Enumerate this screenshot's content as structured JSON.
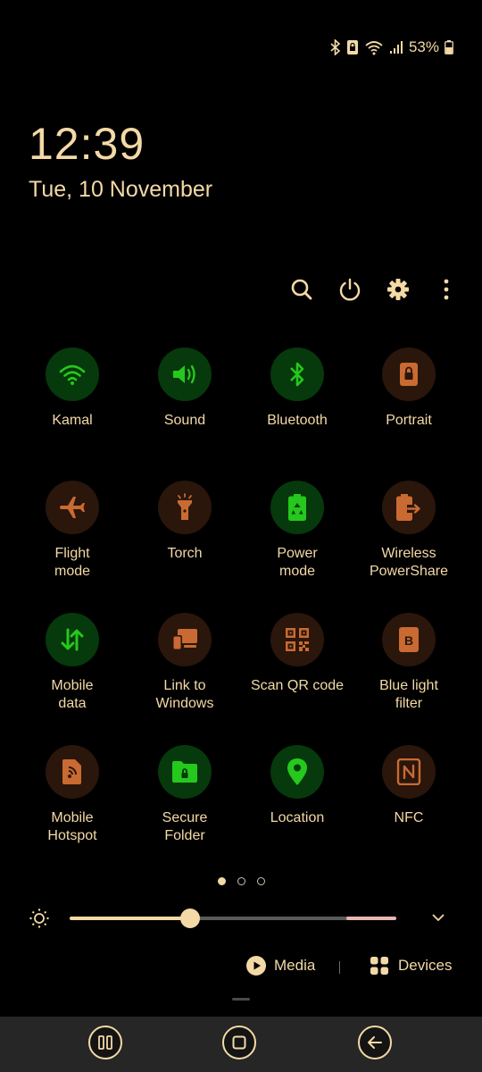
{
  "status_bar": {
    "battery": "53%"
  },
  "lock": {
    "time": "12:39",
    "date": "Tue, 10 November"
  },
  "colors": {
    "accent": "#f3d9a6",
    "tile_on": "#06390c",
    "tile_off": "#2a160b",
    "icon_on": "#25c81c",
    "icon_off": "#c96a32"
  },
  "tiles": [
    {
      "label": "Kamal",
      "icon": "wifi-icon",
      "on": true
    },
    {
      "label": "Sound",
      "icon": "volume-icon",
      "on": true
    },
    {
      "label": "Bluetooth",
      "icon": "bluetooth-icon",
      "on": true
    },
    {
      "label": "Portrait",
      "icon": "portrait-lock-icon",
      "on": false
    },
    {
      "label": "Flight\nmode",
      "icon": "airplane-icon",
      "on": false
    },
    {
      "label": "Torch",
      "icon": "flashlight-icon",
      "on": false
    },
    {
      "label": "Power\nmode",
      "icon": "battery-recycle-icon",
      "on": true
    },
    {
      "label": "Wireless\nPowerShare",
      "icon": "battery-share-icon",
      "on": false
    },
    {
      "label": "Mobile\ndata",
      "icon": "data-arrows-icon",
      "on": true
    },
    {
      "label": "Link to\nWindows",
      "icon": "link-windows-icon",
      "on": false
    },
    {
      "label": "Scan QR code",
      "icon": "qr-code-icon",
      "on": false
    },
    {
      "label": "Blue light\nfilter",
      "icon": "blue-light-icon",
      "on": false
    },
    {
      "label": "Mobile\nHotspot",
      "icon": "hotspot-icon",
      "on": false
    },
    {
      "label": "Secure\nFolder",
      "icon": "secure-folder-icon",
      "on": true
    },
    {
      "label": "Location",
      "icon": "location-pin-icon",
      "on": true
    },
    {
      "label": "NFC",
      "icon": "nfc-icon",
      "on": false
    }
  ],
  "pager": {
    "pages": 3,
    "current": 0
  },
  "brightness": {
    "level": 0.37
  },
  "media_row": {
    "media_label": "Media",
    "devices_label": "Devices"
  }
}
